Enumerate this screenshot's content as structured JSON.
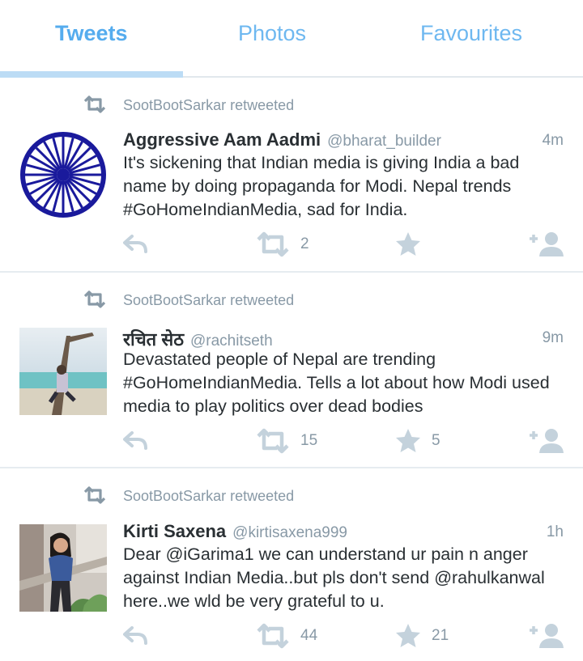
{
  "tabs": [
    {
      "label": "Tweets",
      "active": true
    },
    {
      "label": "Photos",
      "active": false
    },
    {
      "label": "Favourites",
      "active": false
    }
  ],
  "colors": {
    "accent": "#55acee",
    "muted": "#8899a6",
    "icon": "#c4d2dc",
    "text": "#292f33"
  },
  "tweets": [
    {
      "retweeted_by": "SootBootSarkar retweeted",
      "name": "Aggressive Aam Aadmi",
      "handle": "@bharat_builder",
      "time": "4m",
      "text": "It's sickening that Indian media is giving India a bad name by doing propaganda for Modi. Nepal trends #GoHomeIndianMedia, sad for India.",
      "retweets": "2",
      "favorites": "",
      "avatar": "ashoka-chakra"
    },
    {
      "retweeted_by": "SootBootSarkar retweeted",
      "name": "रचित सेठ",
      "handle": "@rachitseth",
      "time": "9m",
      "text": "Devastated people of Nepal are trending #GoHomeIndianMedia. Tells a lot about how Modi used media to play politics over dead bodies",
      "retweets": "15",
      "favorites": "5",
      "avatar": "beach-photo"
    },
    {
      "retweeted_by": "SootBootSarkar retweeted",
      "name": "Kirti Saxena",
      "handle": "@kirtisaxena999",
      "time": "1h",
      "text": "Dear @iGarima1 we can understand ur pain n anger against Indian Media..but pls don't send @rahulkanwal here..we wld be very grateful to u.",
      "retweets": "44",
      "favorites": "21",
      "avatar": "person-photo"
    }
  ]
}
